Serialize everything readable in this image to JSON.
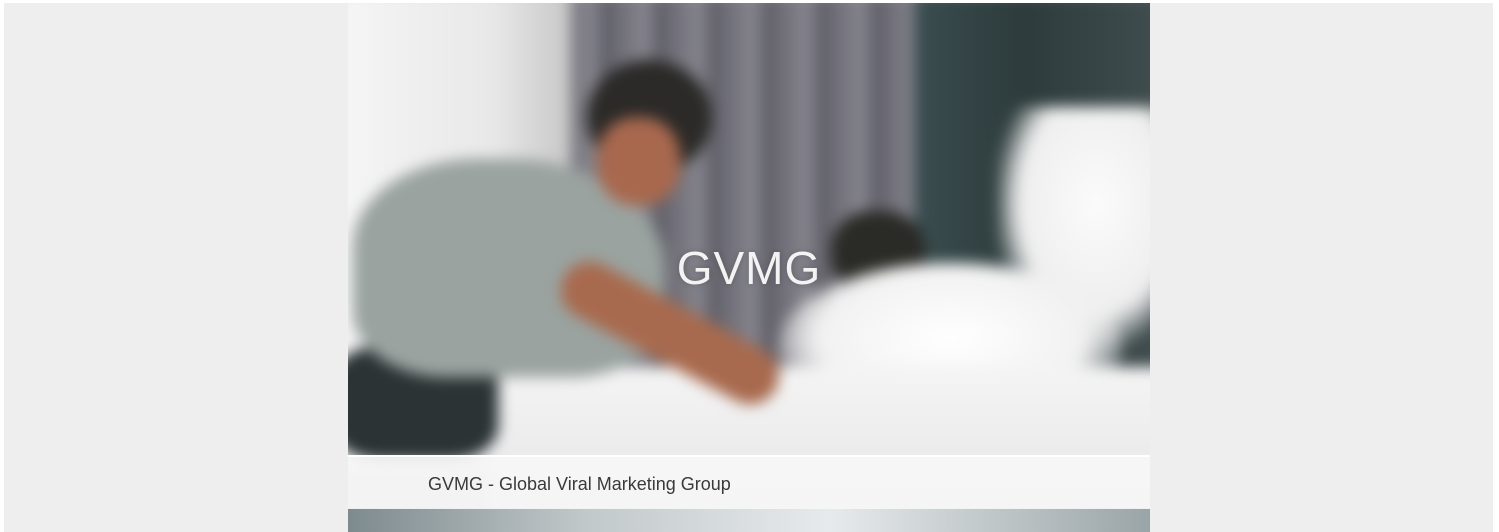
{
  "hero": {
    "title": "GVMG",
    "caption": "GVMG - Global Viral Marketing Group"
  }
}
